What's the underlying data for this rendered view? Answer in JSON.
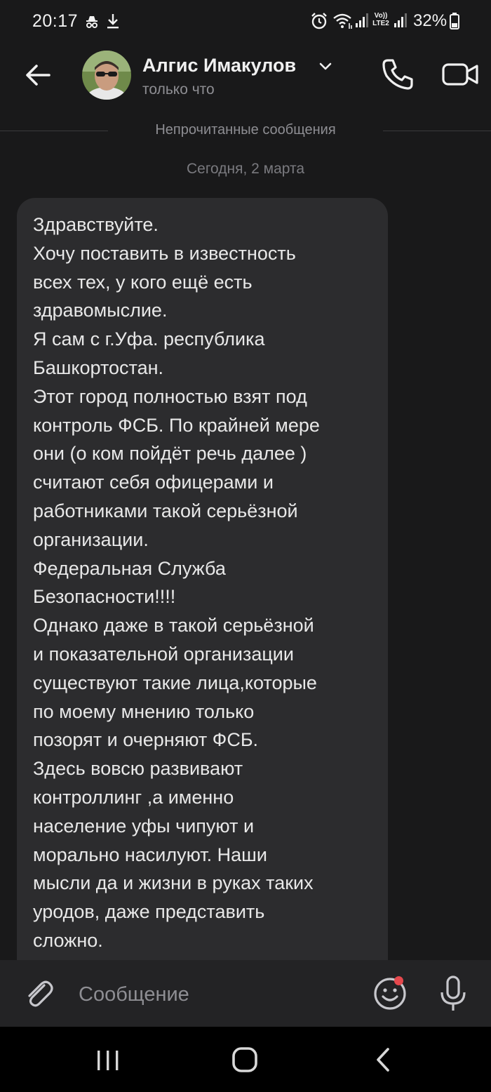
{
  "status_bar": {
    "time": "20:17",
    "battery": "32%",
    "icons": [
      "incognito-icon",
      "download-icon",
      "alarm-icon",
      "wifi-icon",
      "signal-icon",
      "volte-icon",
      "signal-icon",
      "battery-icon"
    ],
    "volte_label": "Vo)) LTE2"
  },
  "header": {
    "contact_name": "Алгис Имакулов",
    "contact_status": "только что",
    "icons": {
      "back": "back-arrow-icon",
      "call": "phone-icon",
      "video": "video-camera-icon",
      "chevron": "chevron-down-icon"
    }
  },
  "chat": {
    "unread_divider": "Непрочитанные сообщения",
    "date_label": "Сегодня, 2 марта",
    "message": {
      "lines": [
        "Здравствуйте.",
        "Хочу поставить в известность",
        "всех тех, у кого ещё есть",
        "здравомыслие.",
        "Я сам с г.Уфа. республика",
        "Башкортостан.",
        "Этот город полностью взят под",
        "контроль ФСБ. По крайней мере",
        "они (о ком пойдёт речь далее )",
        "считают себя офицерами и",
        "работниками такой серьёзной",
        "организации.",
        "Федеральная Служба",
        "Безопасности!!!!",
        "Однако даже в такой серьёзной",
        "и показательной организации",
        "существуют такие лица,которые",
        "по моему мнению только",
        "позорят и очерняют ФСБ.",
        "Здесь вовсю развивают",
        "контроллинг ,а именно",
        "население уфы чипуют и",
        "морально насилуют. Наши",
        "мысли да и жизни в руках таких",
        "уродов, даже представить",
        "сложно."
      ]
    }
  },
  "composer": {
    "placeholder": "Сообщение",
    "icons": {
      "attach": "paperclip-icon",
      "emoji": "emoji-icon",
      "mic": "microphone-icon"
    },
    "notification_dot_color": "#e5484d"
  },
  "nav_bar": {
    "icons": {
      "recent": "recent-apps-icon",
      "home": "home-icon",
      "back": "nav-back-icon"
    }
  },
  "colors": {
    "background": "#19191a",
    "bubble": "#2c2c2e",
    "composer": "#232325",
    "secondary_text": "#8e8e93"
  }
}
